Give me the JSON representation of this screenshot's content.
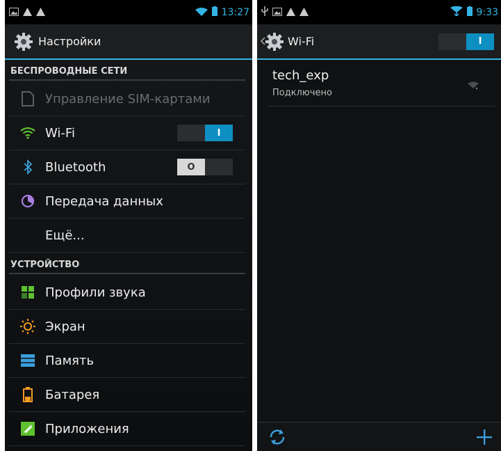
{
  "left": {
    "status": {
      "time": "13:27"
    },
    "header": {
      "title": "Настройки"
    },
    "sections": {
      "wireless": "БЕСПРОВОДНЫЕ СЕТИ",
      "device": "УСТРОЙСТВО"
    },
    "items": {
      "sim": "Управление SIM-картами",
      "wifi": "Wi-Fi",
      "bluetooth": "Bluetooth",
      "data": "Передача данных",
      "more": "Ещё...",
      "sound": "Профили звука",
      "screen": "Экран",
      "memory": "Память",
      "battery": "Батарея",
      "apps": "Приложения"
    },
    "toggles": {
      "wifi_state": "I",
      "bluetooth_state": "O"
    }
  },
  "right": {
    "status": {
      "time": "9:33"
    },
    "header": {
      "title": "Wi-Fi",
      "toggle_state": "I"
    },
    "network": {
      "name": "tech_exp",
      "status": "Подключено"
    }
  },
  "colors": {
    "accent": "#33b5e5",
    "toggle_on": "#0e8fc2",
    "background": "#101215"
  }
}
